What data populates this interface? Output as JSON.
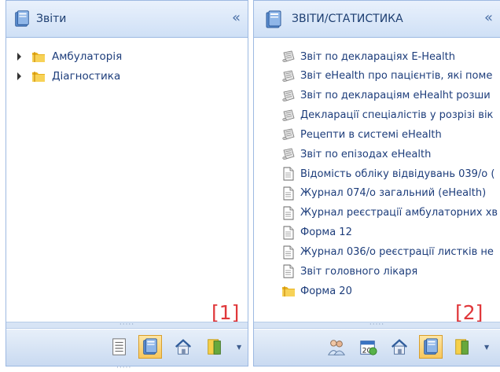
{
  "left_panel": {
    "title": "Звіти",
    "collapse_glyph": "«",
    "tree": [
      {
        "label": "Амбулаторія"
      },
      {
        "label": "Діагностика"
      }
    ],
    "marker": "[1]",
    "toolbar_icons": [
      "report-list-icon",
      "books-icon",
      "home-icon",
      "book-folder-icon"
    ]
  },
  "right_panel": {
    "title": "ЗВІТИ/СТАТИСТИКА",
    "collapse_glyph": "«",
    "items": [
      {
        "label": "Звіт по деклараціях E-Health",
        "icon": "rolled-report-icon"
      },
      {
        "label": "Звіт eHealth про пацієнтів, які поме",
        "icon": "rolled-report-icon"
      },
      {
        "label": "Звіт по деклараціям eHealht розши",
        "icon": "rolled-report-icon"
      },
      {
        "label": "Декларації спеціалістів у розрізі вік",
        "icon": "rolled-report-icon"
      },
      {
        "label": "Рецепти в системі eHealth",
        "icon": "rolled-report-icon"
      },
      {
        "label": "Звіт по епізодах eHealth",
        "icon": "rolled-report-icon"
      },
      {
        "label": "Відомість обліку відвідувань 039/о (",
        "icon": "document-icon"
      },
      {
        "label": "Журнал 074/о загальний (eHealth)",
        "icon": "document-icon"
      },
      {
        "label": "Журнал реєстрації амбулаторних хв",
        "icon": "document-icon"
      },
      {
        "label": "Форма 12",
        "icon": "document-icon"
      },
      {
        "label": "Журнал 036/о реєстрації листків не",
        "icon": "document-icon"
      },
      {
        "label": "Звіт головного лікаря",
        "icon": "document-icon"
      },
      {
        "label": "Форма 20",
        "icon": "folder-icon"
      }
    ],
    "marker": "[2]",
    "toolbar_icons": [
      "doctors-icon",
      "calendar-icon",
      "home-icon",
      "books-icon",
      "book-folder-icon"
    ]
  },
  "colors": {
    "header_text": "#1e3f72",
    "item_text": "#1d3d7b",
    "border": "#9db9e2",
    "marker": "#e0383b",
    "active_button": "#f7c75d"
  }
}
